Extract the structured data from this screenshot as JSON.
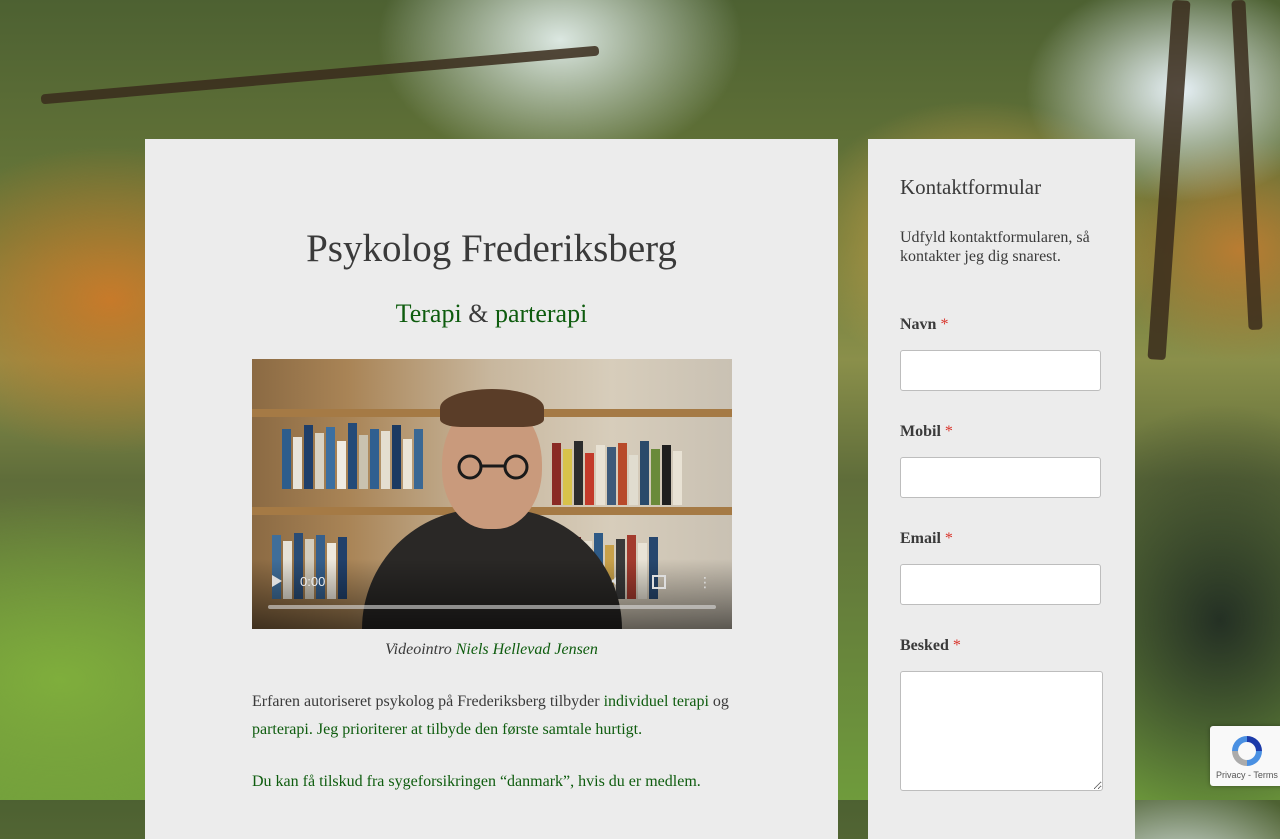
{
  "header": {
    "title": "Psykolog Frederiksberg",
    "tagline": {
      "link1": "Terapi",
      "sep": " & ",
      "link2": "parterapi"
    }
  },
  "video": {
    "time": "0:00",
    "caption_prefix": "Videointro ",
    "caption_link": "Niels Hellevad Jensen"
  },
  "content": {
    "p1_text1": "Erfaren autoriseret psykolog på Frederiksberg tilbyder ",
    "p1_link1": "individuel terapi",
    "p1_text2": " og ",
    "p1_link2": "parterapi",
    "p1_link3": ". Jeg prioriterer at tilbyde den første samtale hurtigt.",
    "p2_link": "Du kan få tilskud fra sygeforsikringen “danmark”, hvis du er medlem."
  },
  "sidebar": {
    "title": "Kontaktformular",
    "intro": "Udfyld kontaktformularen, så kontakter jeg dig snarest.",
    "required_mark": "*",
    "fields": [
      {
        "label": "Navn"
      },
      {
        "label": "Mobil"
      },
      {
        "label": "Email"
      },
      {
        "label": "Besked"
      }
    ]
  },
  "recaptcha": {
    "terms": "Privacy - Terms"
  }
}
